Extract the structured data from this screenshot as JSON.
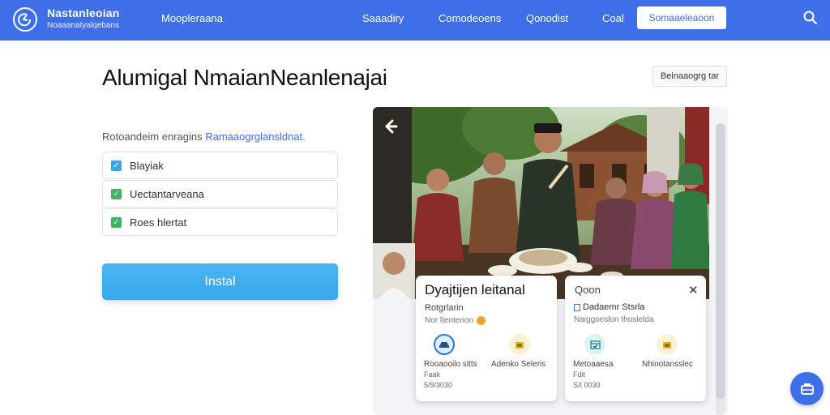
{
  "nav": {
    "brand_title": "Nastanleoian",
    "brand_sub": "Noaaanatyalqebans",
    "items": [
      {
        "label": "Moopleraana"
      },
      {
        "label": "Saaadiry"
      },
      {
        "label": "Comodeoens"
      },
      {
        "label": "Qonodist"
      },
      {
        "label": "Coal"
      }
    ],
    "cta_label": "Somaaeleaoon",
    "accent": "#3f6fe8"
  },
  "page": {
    "title": "Alumigal NmaianNeanlenajai",
    "top_right_label": "Beinaaogrg tar"
  },
  "form": {
    "intro_text": "Rotoandeim enragins",
    "intro_link": "Ramaaogrglansldnat.",
    "options": [
      {
        "label": "Blayiak",
        "checked": true,
        "color": "#3ba5e8"
      },
      {
        "label": "Uectantarveana",
        "checked": true,
        "color": "#3fb35d"
      },
      {
        "label": "Roes hlertat",
        "checked": true,
        "color": "#3fb35d"
      }
    ],
    "install_label": "Instal"
  },
  "card_a": {
    "title": "Dyajtijen leitanal",
    "subtitle": "Rotgrlarin",
    "meta": "Nor ltenterion",
    "features": [
      {
        "label": "Rooaooilo sitts",
        "meta1": "Faak",
        "meta2": "5/9/3030",
        "icon": "car-icon",
        "icon_color": "#2b7ad8"
      },
      {
        "label": "Adenko Seleris",
        "meta1": "",
        "meta2": "",
        "icon": "bag-icon",
        "icon_color": "#e6b52a"
      }
    ]
  },
  "card_b": {
    "title": "Qoon",
    "subtitle": "Dadaemr Stsrla",
    "meta": "Naiggoeslon thoslelda",
    "features": [
      {
        "label": "Metoaaesa",
        "meta1": "Fdit",
        "meta2": "S/I 0030",
        "icon": "calendar-icon",
        "icon_color": "#2b9d9f"
      },
      {
        "label": "Nhinotansslec",
        "meta1": "",
        "meta2": "",
        "icon": "bag-icon",
        "icon_color": "#e6b52a"
      }
    ]
  }
}
